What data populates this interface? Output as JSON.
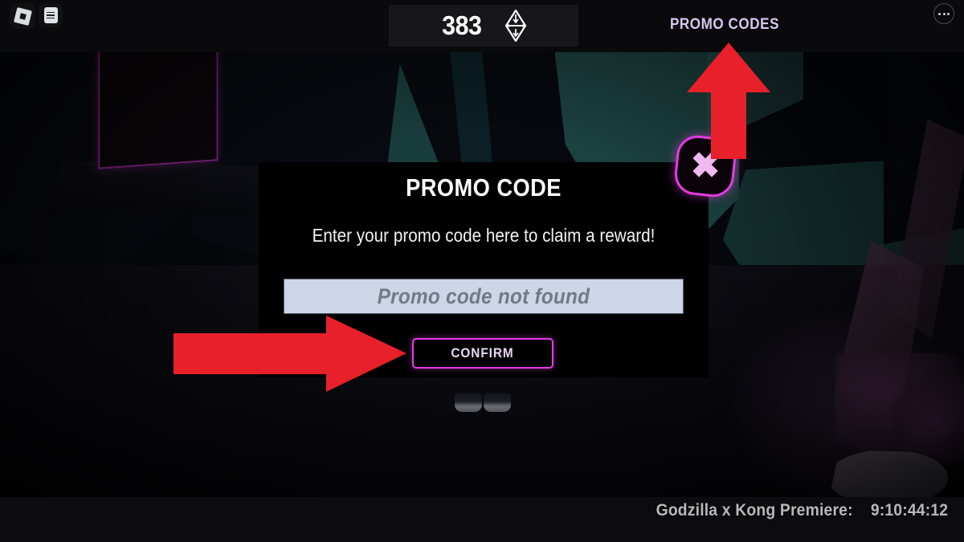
{
  "topbar": {
    "roblox_icon": "roblox-logo-icon",
    "menu_icon": "menu-sheet-icon",
    "currency": {
      "amount": "383",
      "icon": "gem-icon"
    },
    "promo_codes_label": "PROMO CODES",
    "more_icon": "more-options-icon"
  },
  "dialog": {
    "title": "PROMO CODE",
    "subtitle": "Enter your promo code here to claim a reward!",
    "input": {
      "value": "",
      "placeholder": "Promo code not found"
    },
    "confirm_label": "CONFIRM",
    "close_icon": "close-x-icon"
  },
  "annotations": {
    "arrow_up": "red-arrow-up",
    "arrow_right": "red-arrow-right",
    "color": "#e8202a"
  },
  "footer": {
    "event_label": "Godzilla x Kong Premiere:",
    "countdown": "9:10:44:12"
  },
  "colors": {
    "accent_magenta": "#e43ce4",
    "accent_lavender": "#d9c8f2",
    "input_bg": "#ccd6e8",
    "dialog_bg": "#000000",
    "annotation_red": "#e8202a"
  }
}
